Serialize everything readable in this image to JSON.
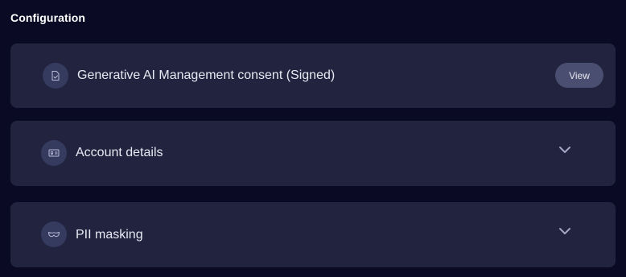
{
  "section": {
    "title": "Configuration"
  },
  "cards": {
    "consent": {
      "label": "Generative AI Management consent (Signed)",
      "icon": "signed-document-icon",
      "action_label": "View"
    },
    "account": {
      "label": "Account details",
      "icon": "id-card-icon",
      "expand_icon": "chevron-down-icon"
    },
    "pii": {
      "label": "PII masking",
      "icon": "mask-icon",
      "expand_icon": "chevron-down-icon"
    }
  },
  "colors": {
    "background": "#0a0a25",
    "card": "#22233f",
    "icon_circle": "#353a5f",
    "button": "#4a4e70"
  }
}
